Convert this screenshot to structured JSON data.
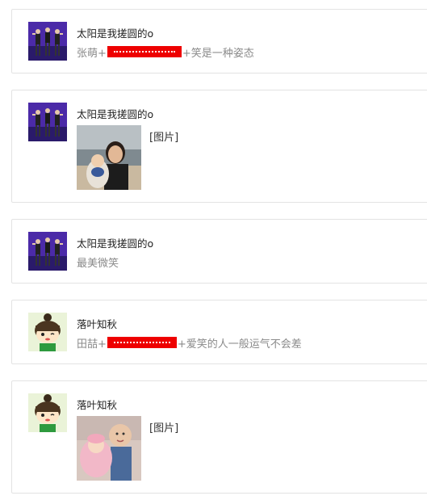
{
  "posts": [
    {
      "user": "太阳是我搓圆的o",
      "avatar": "dancers-avatar",
      "type": "text",
      "text_before": "张萌+",
      "redacted": true,
      "text_after": "+笑是一种姿态"
    },
    {
      "user": "太阳是我搓圆的o",
      "avatar": "dancers-avatar",
      "type": "image",
      "photo": "woman-child-beach-photo",
      "image_label": "[图片]"
    },
    {
      "user": "太阳是我搓圆的o",
      "avatar": "dancers-avatar",
      "type": "text",
      "text_before": "最美微笑",
      "redacted": false,
      "text_after": ""
    },
    {
      "user": "落叶知秋",
      "avatar": "cartoon-girl-avatar",
      "type": "text",
      "text_before": "田喆+",
      "redacted": true,
      "text_after": "+爱笑的人一般运气不会差"
    },
    {
      "user": "落叶知秋",
      "avatar": "cartoon-girl-avatar",
      "type": "image",
      "photo": "children-photo",
      "image_label": "[图片]"
    }
  ],
  "colors": {
    "redaction": "#ee0000",
    "card_border": "#e3e3e3",
    "muted_text": "#8a8a8a"
  }
}
